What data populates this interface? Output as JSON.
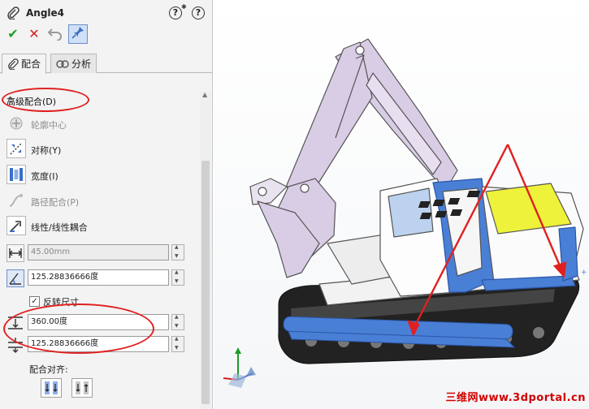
{
  "property_manager": {
    "title": "Angle4",
    "help_glyph": "?",
    "tabs": [
      {
        "label": "配合",
        "icon": "paperclip-icon",
        "active": true
      },
      {
        "label": "分析",
        "icon": "analysis-icon",
        "active": false
      }
    ],
    "section_title": "高级配合(D)",
    "options": [
      {
        "label": "轮廓中心",
        "icon": "profile-center-icon",
        "enabled": false
      },
      {
        "label": "对称(Y)",
        "icon": "symmetric-icon",
        "enabled": true
      },
      {
        "label": "宽度(I)",
        "icon": "width-icon",
        "enabled": true
      },
      {
        "label": "路径配合(P)",
        "icon": "path-mate-icon",
        "enabled": false
      },
      {
        "label": "线性/线性耦合",
        "icon": "linear-coupler-icon",
        "enabled": true
      }
    ],
    "fields": {
      "distance": "45.00mm",
      "angle": "125.28836666度",
      "max_angle": "360.00度",
      "min_angle": "125.28836666度"
    },
    "flip_dimension": {
      "label": "反转尺寸",
      "checked": true
    },
    "mate_alignment_label": "配合对齐:"
  },
  "watermark": "三维网www.3dportal.cn",
  "colors": {
    "accent_blue": "#4a7fd6",
    "boom_lilac": "#d9cde6",
    "cab_yellow": "#eef23a",
    "annotation_red": "#e02020",
    "confirm_green": "#1f9d2a"
  }
}
